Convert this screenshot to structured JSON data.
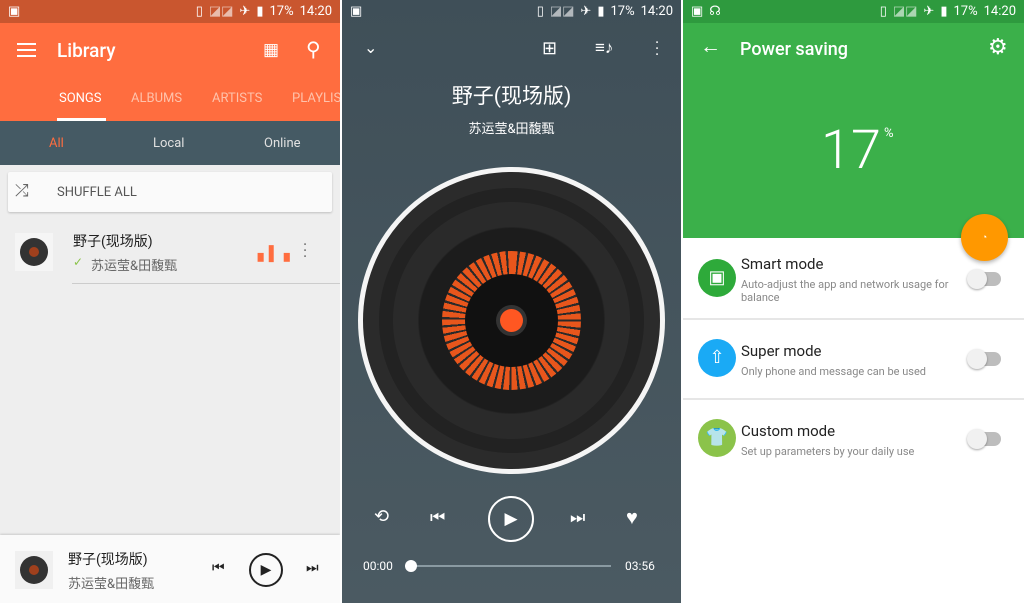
{
  "status_bar": {
    "battery": "17%",
    "time": "14:20"
  },
  "library": {
    "title": "Library",
    "tabs": [
      "SONGS",
      "ALBUMS",
      "ARTISTS",
      "PLAYLISTS"
    ],
    "active_tab": "SONGS",
    "filters": [
      "All",
      "Local",
      "Online"
    ],
    "active_filter": "All",
    "shuffle_label": "SHUFFLE ALL",
    "songs": [
      {
        "title": "野子(现场版)",
        "artist": "苏运莹&田馥甄"
      }
    ],
    "mini_player": {
      "title": "野子(现场版)",
      "artist": "苏运莹&田馥甄"
    },
    "colors": {
      "accent": "#ff6d3f",
      "filter_bar": "#455a64"
    }
  },
  "player": {
    "title": "野子(现场版)",
    "artist": "苏运莹&田馥甄",
    "elapsed": "00:00",
    "duration": "03:56",
    "progress": 0
  },
  "power": {
    "title": "Power saving",
    "battery_value": "17",
    "battery_unit": "%",
    "modes": [
      {
        "name": "Smart mode",
        "desc_line1": "Auto-adjust the app and network usage for",
        "desc_line2": "balance",
        "color": "#2eaa3a",
        "icon": "android-icon",
        "enabled": false
      },
      {
        "name": "Super mode",
        "desc_line1": "Only phone and message can be used",
        "desc_line2": "",
        "color": "#1aaaf5",
        "icon": "rocket-icon",
        "enabled": false
      },
      {
        "name": "Custom mode",
        "desc_line1": "Set up parameters by your daily use",
        "desc_line2": "",
        "color": "#8bc34a",
        "icon": "shirt-icon",
        "enabled": false
      }
    ],
    "colors": {
      "header": "#3bb04a",
      "fab": "#ff9800"
    }
  }
}
